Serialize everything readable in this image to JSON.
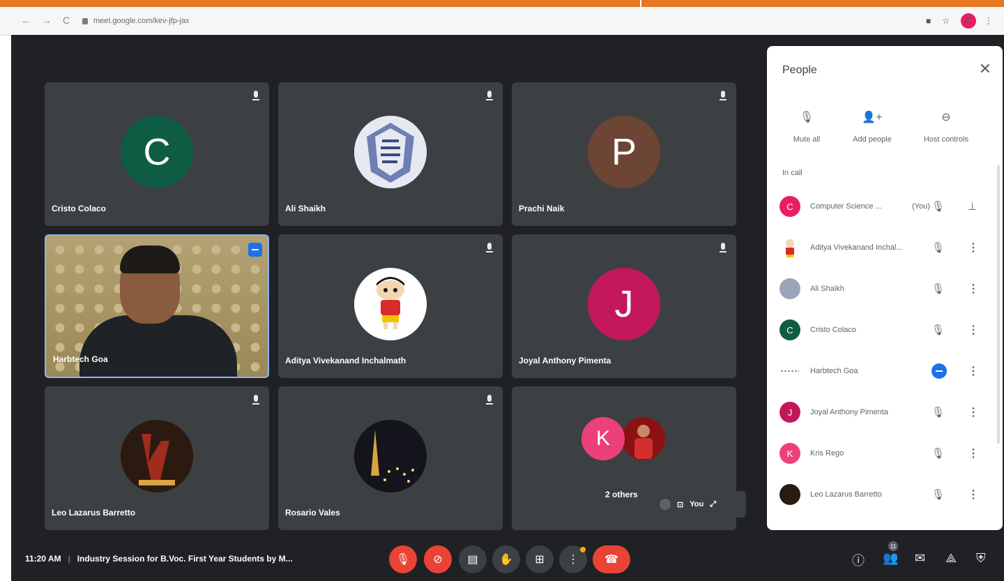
{
  "browser": {
    "url": "meet.google.com/kev-jfp-jax",
    "profile_initial": "C"
  },
  "tiles": [
    {
      "name": "Cristo Colaco",
      "initial": "C",
      "color": "#0f5c45"
    },
    {
      "name": "Ali Shaikh",
      "initial": "",
      "color": "#c8cfe0"
    },
    {
      "name": "Prachi Naik",
      "initial": "P",
      "color": "#6d4535"
    },
    {
      "name": "Harbtech Goa",
      "initial": "",
      "color": ""
    },
    {
      "name": "Aditya Vivekanand Inchalmath",
      "initial": "",
      "color": "#ffffff"
    },
    {
      "name": "Joyal Anthony Pimenta",
      "initial": "J",
      "color": "#c2185b"
    },
    {
      "name": "Leo Lazarus Barretto",
      "initial": "",
      "color": "#2b1a10"
    },
    {
      "name": "Rosario Vales",
      "initial": "",
      "color": "#1a1a1a"
    }
  ],
  "others_tile": {
    "initial": "K",
    "label": "2 others"
  },
  "self_view": {
    "label": "You"
  },
  "people_panel": {
    "title": "People",
    "actions": {
      "mute_all": "Mute all",
      "add_people": "Add people",
      "host_controls": "Host controls"
    },
    "section_label": "In call",
    "participants": [
      {
        "name": "Computer Science ...",
        "suffix": "(You)",
        "initial": "C",
        "color": "#e91e63"
      },
      {
        "name": "Aditya Vivekanand Inchal...",
        "suffix": "",
        "initial": "",
        "color": "#f0a030"
      },
      {
        "name": "Ali Shaikh",
        "suffix": "",
        "initial": "",
        "color": "#9aa3b8"
      },
      {
        "name": "Cristo Colaco",
        "suffix": "",
        "initial": "C",
        "color": "#0f5c45"
      },
      {
        "name": "Harbtech Goa",
        "suffix": "",
        "initial": "",
        "color": ""
      },
      {
        "name": "Joyal Anthony Pimenta",
        "suffix": "",
        "initial": "J",
        "color": "#c2185b"
      },
      {
        "name": "Kris Rego",
        "suffix": "",
        "initial": "K",
        "color": "#ec407a"
      },
      {
        "name": "Leo Lazarus Barretto",
        "suffix": "",
        "initial": "",
        "color": "#2b1a10"
      }
    ]
  },
  "bottom": {
    "time": "11:20 AM",
    "meeting_title": "Industry Session for B.Voc. First Year Students by M...",
    "participants_count": "11"
  }
}
